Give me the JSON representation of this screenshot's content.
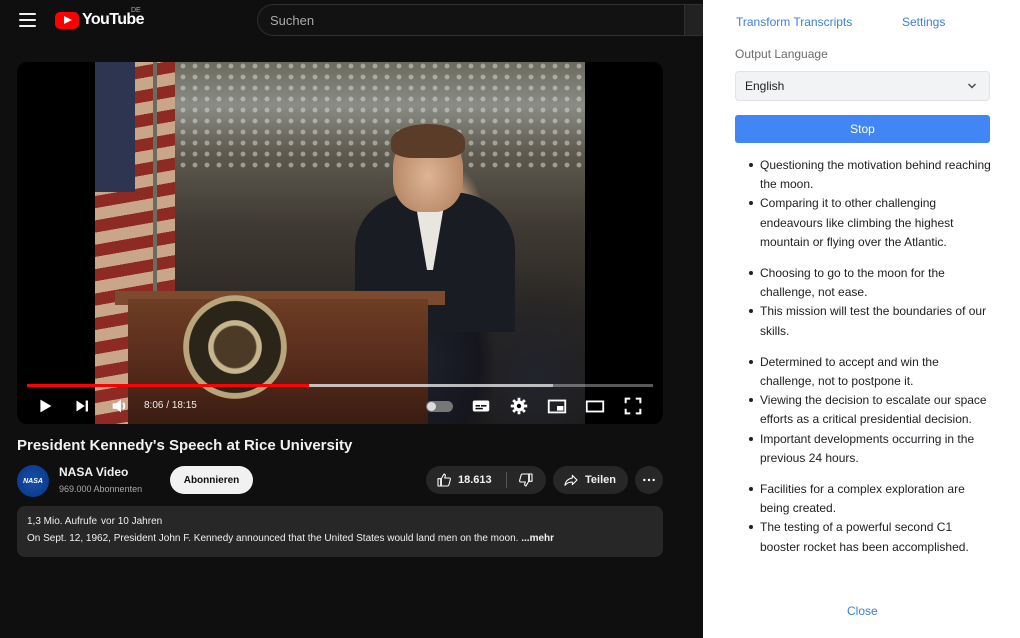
{
  "youtube": {
    "logo_text": "YouTube",
    "logo_country": "DE",
    "search_placeholder": "Suchen",
    "player": {
      "time_current": "8:06",
      "time_total": "18:15",
      "progress_fraction": 0.45,
      "buffered_fraction": 0.84
    },
    "video": {
      "title": "President Kennedy's Speech at Rice University",
      "channel": "NASA Video",
      "avatar_text": "NASA",
      "subscribers": "969.000 Abonnenten",
      "subscribe_label": "Abonnieren",
      "likes": "18.613",
      "share_label": "Teilen",
      "views": "1,3 Mio. Aufrufe",
      "age": "vor 10 Jahren",
      "description": "On Sept. 12, 1962, President John F. Kennedy announced that the United States would land men on the moon.",
      "more_label": "...mehr"
    }
  },
  "panel": {
    "tabs": [
      "Transform Transcripts",
      "Settings"
    ],
    "language_label": "Output Language",
    "language_value": "English",
    "stop_label": "Stop",
    "close_label": "Close",
    "bullet_groups": [
      [
        "Questioning the motivation behind reaching the moon.",
        "Comparing it to other challenging endeavours like climbing the highest mountain or flying over the Atlantic."
      ],
      [
        "Choosing to go to the moon for the challenge, not ease.",
        "This mission will test the boundaries of our skills."
      ],
      [
        "Determined to accept and win the challenge, not to postpone it.",
        "Viewing the decision to escalate our space efforts as a critical presidential decision.",
        "Important developments occurring in the previous 24 hours."
      ],
      [
        "Facilities for a complex exploration are being created.",
        "The testing of a powerful second C1 booster rocket has been accomplished."
      ]
    ]
  },
  "colors": {
    "youtube_red": "#ff0000",
    "panel_link": "#3b7fd9",
    "stop_button": "#4285f4",
    "dark_bg": "#0f0f0f"
  }
}
